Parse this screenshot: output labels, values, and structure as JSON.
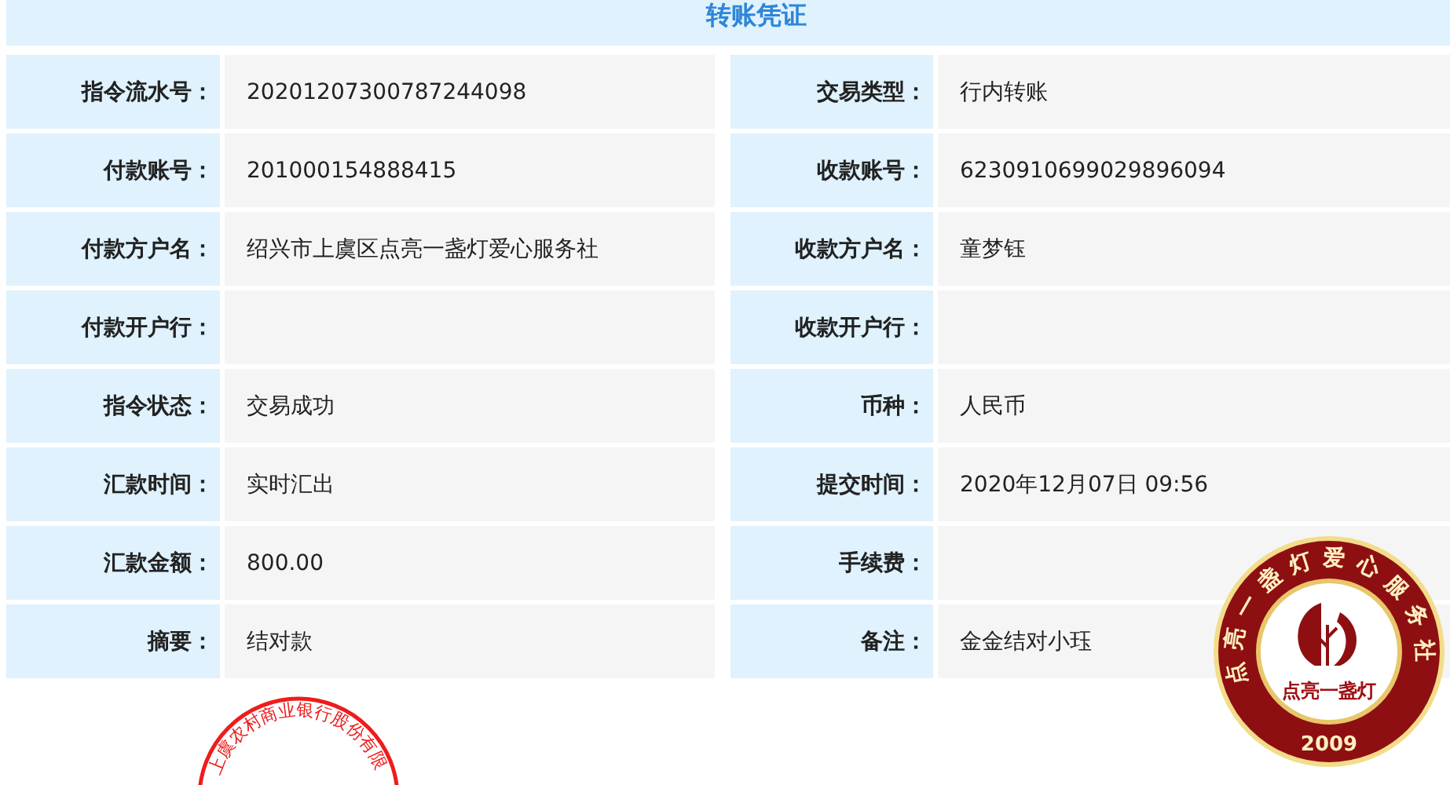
{
  "title": "转账凭证",
  "rows": [
    {
      "label": "指令流水号：",
      "value": "20201207300787244098"
    },
    {
      "label": "交易类型：",
      "value": "行内转账"
    },
    {
      "label": "付款账号：",
      "value": "201000154888415"
    },
    {
      "label": "收款账号：",
      "value": "6230910699029896094"
    },
    {
      "label": "付款方户名：",
      "value": "绍兴市上虞区点亮一盏灯爱心服务社"
    },
    {
      "label": "收款方户名：",
      "value": "童梦钰"
    },
    {
      "label": "付款开户行："
    },
    {
      "label": "收款开户行："
    },
    {
      "label": "指令状态：",
      "value": "交易成功"
    },
    {
      "label": "币种：",
      "value": "人民币"
    },
    {
      "label": "汇款时间：",
      "value": "实时汇出"
    },
    {
      "label": "提交时间：",
      "value": "2020年12月07日 09:56"
    },
    {
      "label": "汇款金额：",
      "value": "800.00"
    },
    {
      "label": "手续费："
    },
    {
      "label": "摘要：",
      "value": "结对款"
    },
    {
      "label": "备注：",
      "value": "金金结对小珏"
    }
  ],
  "seals": [
    {
      "kind": "emblem",
      "ring_text": "点亮一盏灯爱心服务社",
      "center_text": "点亮一盏灯",
      "year": "2009"
    },
    {
      "kind": "bank-stamp",
      "ring_text": "上虞农村商业银行股份有限"
    }
  ]
}
